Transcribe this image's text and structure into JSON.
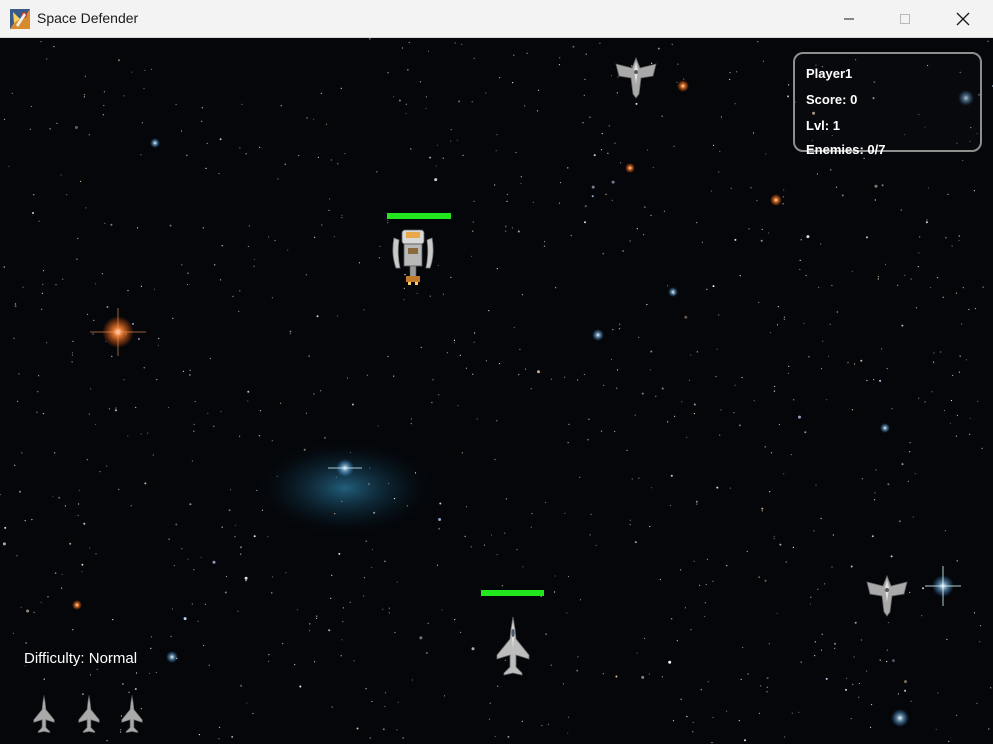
{
  "window": {
    "title": "Space Defender",
    "controls": [
      "minimize-icon",
      "maximize-icon",
      "close-icon"
    ]
  },
  "hud": {
    "player": "Player1",
    "score": "Score: 0",
    "level": "Lvl: 1",
    "enemies": "Enemies: 0/7"
  },
  "difficulty": "Difficulty: Normal",
  "lives": 3,
  "health": {
    "boss": 1.0,
    "player": 1.0
  },
  "colors": {
    "titlebar_bg": "#f3f3f3",
    "health_green": "#22e61e",
    "hud_border": "#8e8e8e",
    "space_bg": "#04060a"
  },
  "sprites": [
    "player-fighter-jet",
    "boss-mothership",
    "enemy-fighter",
    "enemy-fighter",
    "life-icon",
    "life-icon",
    "life-icon"
  ]
}
